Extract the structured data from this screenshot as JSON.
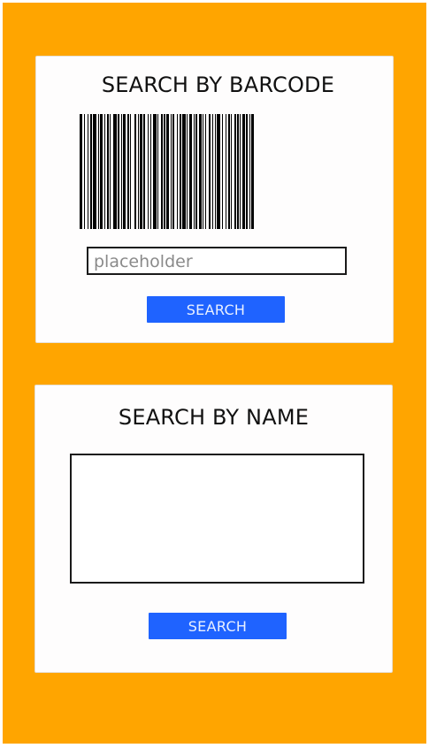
{
  "colors": {
    "background": "#ffa500",
    "card": "#fefdfd",
    "button": "#1f63ff",
    "button_text": "#e9f0ff",
    "border": "#1a1a1a"
  },
  "barcode_section": {
    "title": "SEARCH BY BARCODE",
    "barcode_icon": "barcode-icon",
    "input": {
      "value": "",
      "placeholder": "placeholder"
    },
    "search_label": "SEARCH"
  },
  "name_section": {
    "title": "SEARCH BY NAME",
    "textarea": {
      "value": ""
    },
    "search_label": "SEARCH"
  }
}
